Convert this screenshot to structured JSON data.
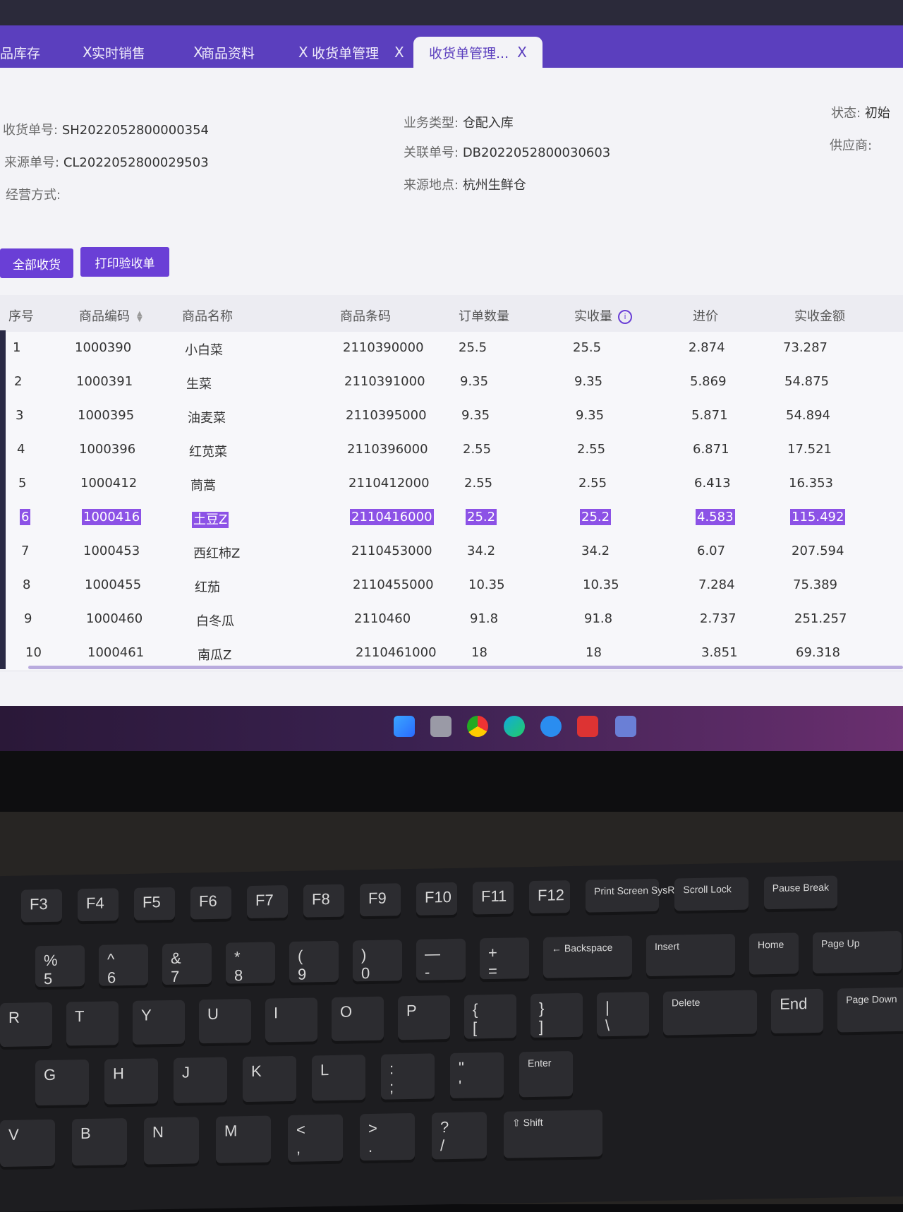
{
  "tabs": [
    {
      "label": "品库存"
    },
    {
      "label": "实时销售"
    },
    {
      "label": "商品资料"
    },
    {
      "label": "收货单管理"
    },
    {
      "label": "收货单管理..."
    }
  ],
  "close_glyph": "X",
  "info": {
    "receipt_no_label": "收货单号:",
    "receipt_no": "SH2022052800000354",
    "source_no_label": "来源单号:",
    "source_no": "CL2022052800029503",
    "mode_label": "经营方式:",
    "biz_type_label": "业务类型:",
    "biz_type": "仓配入库",
    "related_no_label": "关联单号:",
    "related_no": "DB2022052800030603",
    "source_loc_label": "来源地点:",
    "source_loc": "杭州生鲜仓",
    "status_label": "状态:",
    "status": "初始",
    "supplier_label": "供应商:"
  },
  "buttons": {
    "receive_all": "全部收货",
    "print": "打印验收单"
  },
  "table": {
    "headers": [
      "序号",
      "商品编码",
      "商品名称",
      "商品条码",
      "订单数量",
      "实收量",
      "进价",
      "实收金额"
    ],
    "info_icon": "i",
    "rows": [
      [
        "1",
        "1000390",
        "小白菜",
        "2110390000",
        "25.5",
        "25.5",
        "2.874",
        "73.287"
      ],
      [
        "2",
        "1000391",
        "生菜",
        "2110391000",
        "9.35",
        "9.35",
        "5.869",
        "54.875"
      ],
      [
        "3",
        "1000395",
        "油麦菜",
        "2110395000",
        "9.35",
        "9.35",
        "5.871",
        "54.894"
      ],
      [
        "4",
        "1000396",
        "红苋菜",
        "2110396000",
        "2.55",
        "2.55",
        "6.871",
        "17.521"
      ],
      [
        "5",
        "1000412",
        "茼蒿",
        "2110412000",
        "2.55",
        "2.55",
        "6.413",
        "16.353"
      ],
      [
        "6",
        "1000416",
        "土豆Z",
        "2110416000",
        "25.2",
        "25.2",
        "4.583",
        "115.492"
      ],
      [
        "7",
        "1000453",
        "西红柿Z",
        "2110453000",
        "34.2",
        "34.2",
        "6.07",
        "207.594"
      ],
      [
        "8",
        "1000455",
        "红茄",
        "2110455000",
        "10.35",
        "10.35",
        "7.284",
        "75.389"
      ],
      [
        "9",
        "1000460",
        "白冬瓜",
        "2110460",
        "91.8",
        "91.8",
        "2.737",
        "251.257"
      ],
      [
        "10",
        "1000461",
        "南瓜Z",
        "2110461000",
        "18",
        "18",
        "3.851",
        "69.318"
      ]
    ],
    "selected_row": 6
  },
  "keyboard": {
    "fn": [
      "F3",
      "F4",
      "F5",
      "F6",
      "F7",
      "F8",
      "F9",
      "F10",
      "F11",
      "F12",
      "Print Screen SysRq",
      "Scroll Lock",
      "Pause Break"
    ],
    "num": [
      "%\n5",
      "^\n6",
      "&\n7",
      "*\n8",
      "(\n9",
      ")\n0",
      "—\n-",
      "+\n=",
      "← Backspace",
      "Insert",
      "Home",
      "Page Up"
    ],
    "qrow": [
      "R",
      "T",
      "Y",
      "U",
      "I",
      "O",
      "P",
      "{\n[",
      "}\n]",
      "|\n\\",
      "Delete",
      "End",
      "Page Down"
    ],
    "arow": [
      "G",
      "H",
      "J",
      "K",
      "L",
      ":\n;",
      "\"\n'",
      "Enter"
    ],
    "zrow": [
      "V",
      "B",
      "N",
      "M",
      "<\n,",
      ">\n.",
      "?\n/",
      "⇧ Shift"
    ]
  }
}
